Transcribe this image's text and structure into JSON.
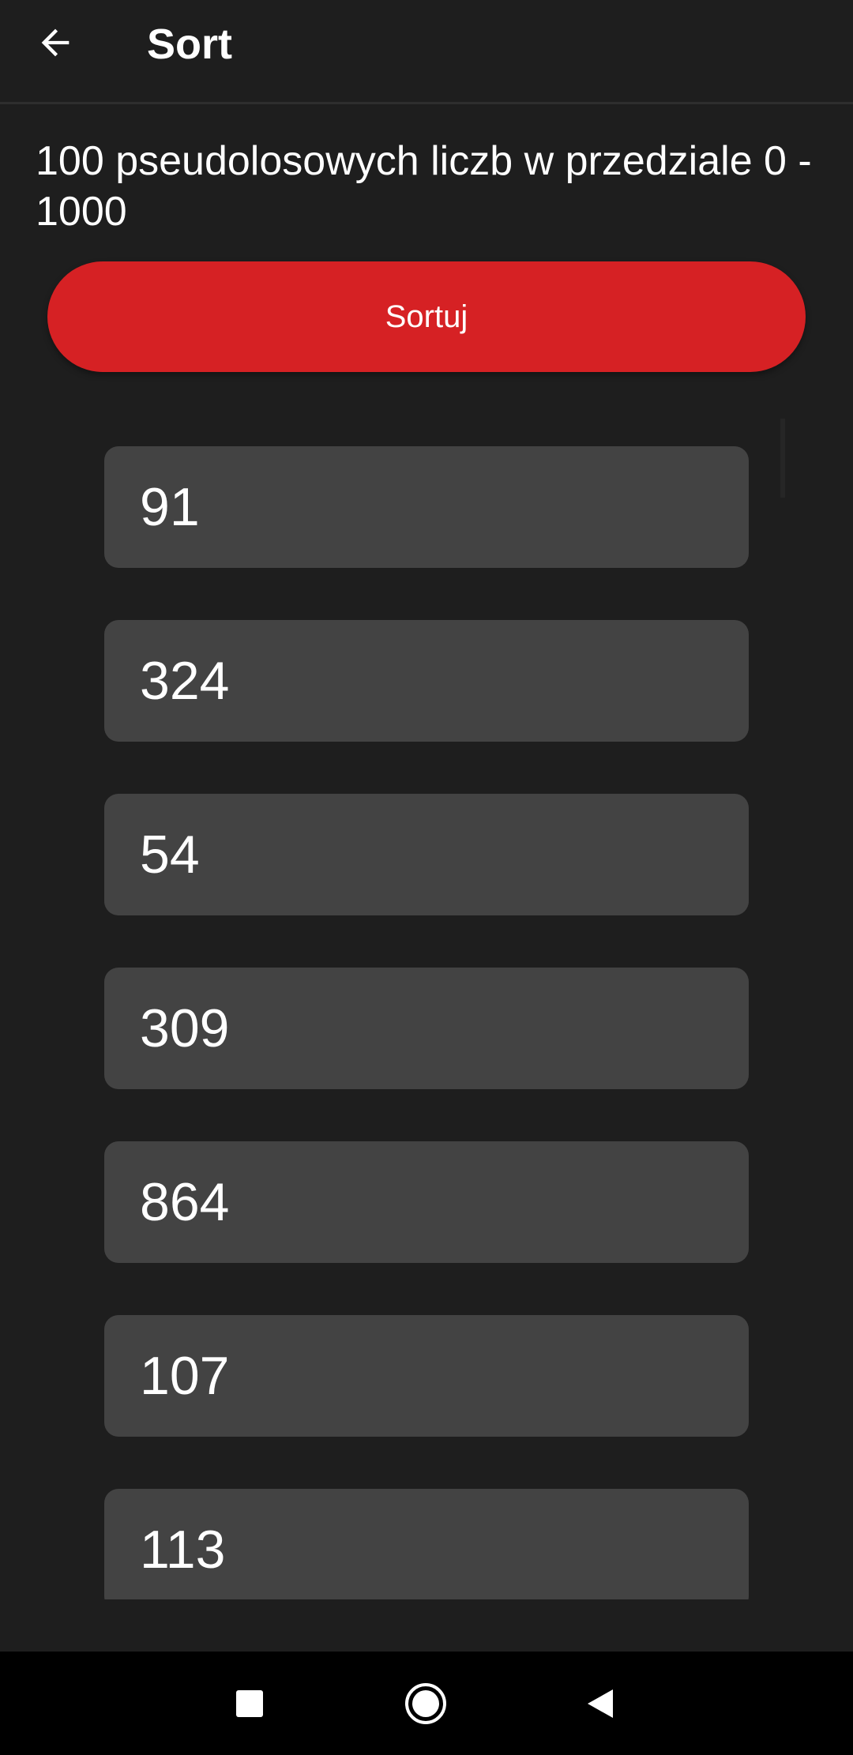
{
  "app_bar": {
    "title": "Sort",
    "back_icon": "arrow-left-icon"
  },
  "description": "100 pseudolosowych liczb w przedziale 0 - 1000",
  "sort_button": {
    "label": "Sortuj",
    "color": "#d62124"
  },
  "numbers": [
    "91",
    "324",
    "54",
    "309",
    "864",
    "107",
    "113"
  ],
  "nav_bar": {
    "recents_icon": "square-icon",
    "home_icon": "circle-icon",
    "back_icon": "triangle-back-icon"
  },
  "colors": {
    "background": "#1e1e1e",
    "card": "#434343",
    "accent": "#d62124"
  }
}
